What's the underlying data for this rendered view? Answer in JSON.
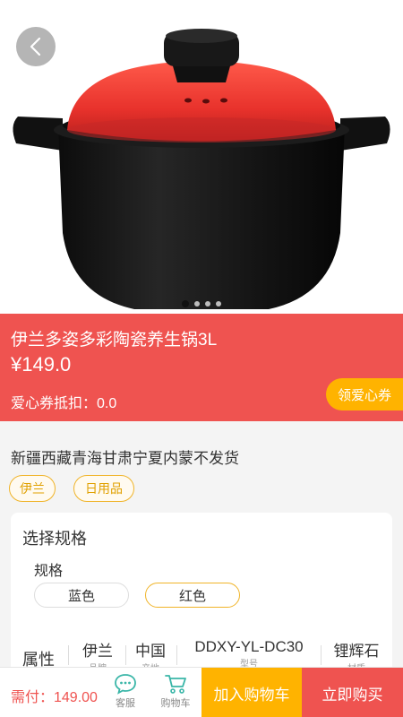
{
  "product": {
    "title": "伊兰多姿多彩陶瓷养生锅3L",
    "price": "¥149.0",
    "coupon_text": "爱心券抵扣：0.0",
    "coupon_button": "领爱心券",
    "shipping_note": "新疆西藏青海甘肃宁夏内蒙不发货",
    "tags": [
      "伊兰",
      "日用品"
    ]
  },
  "gallery": {
    "count": 4,
    "active": 0,
    "icon": "back-arrow-icon"
  },
  "spec": {
    "title": "选择规格",
    "label": "规格",
    "options": [
      "蓝色",
      "红色"
    ],
    "selected": "红色"
  },
  "attributes": {
    "label": "属性",
    "items": [
      {
        "value": "伊兰",
        "key": "品牌"
      },
      {
        "value": "中国",
        "key": "产地"
      },
      {
        "value": "DDXY-YL-DC30",
        "key": "型号"
      },
      {
        "value": "锂辉石",
        "key": "材质"
      }
    ]
  },
  "bottom_bar": {
    "total": "需付：149.00",
    "service_label": "客服",
    "cart_label": "购物车",
    "add_to_cart": "加入购物车",
    "buy_now": "立即购买"
  },
  "colors": {
    "red": "#ef5350",
    "orange": "#ffb300",
    "pot_lid": "#e53935",
    "pot_body": "#151515"
  }
}
